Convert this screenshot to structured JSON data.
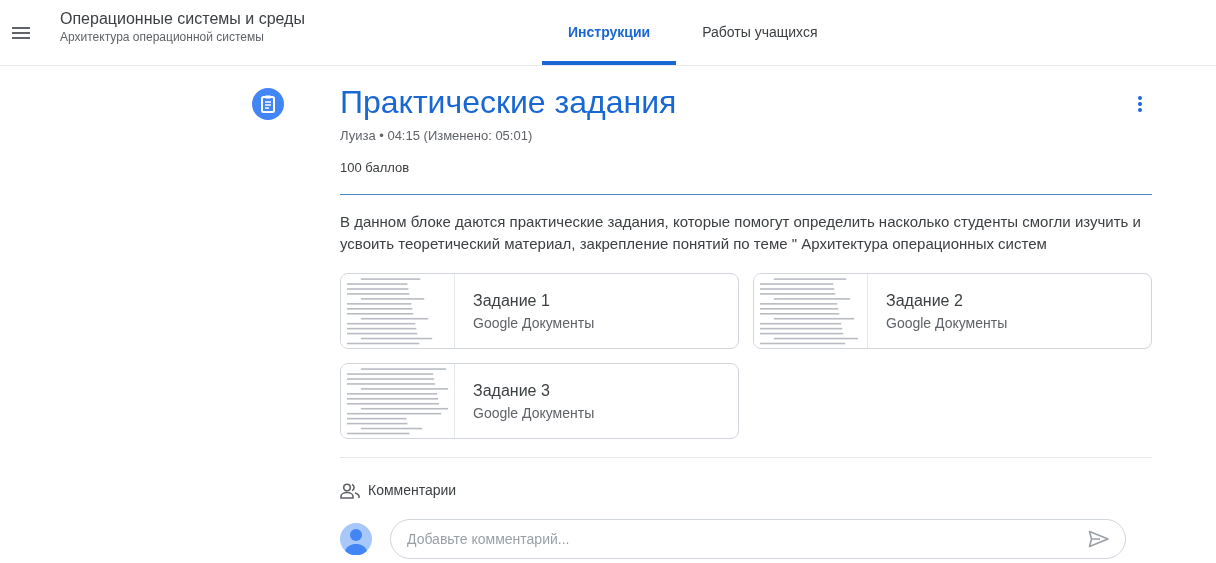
{
  "header": {
    "title": "Операционные системы и среды",
    "subtitle": "Архитектура операционной системы"
  },
  "tabs": [
    {
      "label": "Инструкции",
      "selected": true
    },
    {
      "label": "Работы учащихся",
      "selected": false
    }
  ],
  "assignment": {
    "title": "Практические задания",
    "meta": "Луиза • 04:15 (Изменено: 05:01)",
    "points": "100 баллов",
    "description": "В данном блоке даются практические задания, которые помогут определить насколько студенты смогли изучить и усвоить теоретический материал, закрепление понятий по теме \" Архитектура операционных систем"
  },
  "attachments": [
    {
      "title": "Задание 1",
      "type": "Google Документы"
    },
    {
      "title": "Задание 2",
      "type": "Google Документы"
    },
    {
      "title": "Задание 3",
      "type": "Google Документы"
    }
  ],
  "comments": {
    "heading": "Комментарии",
    "placeholder": "Добавьте комментарий..."
  }
}
